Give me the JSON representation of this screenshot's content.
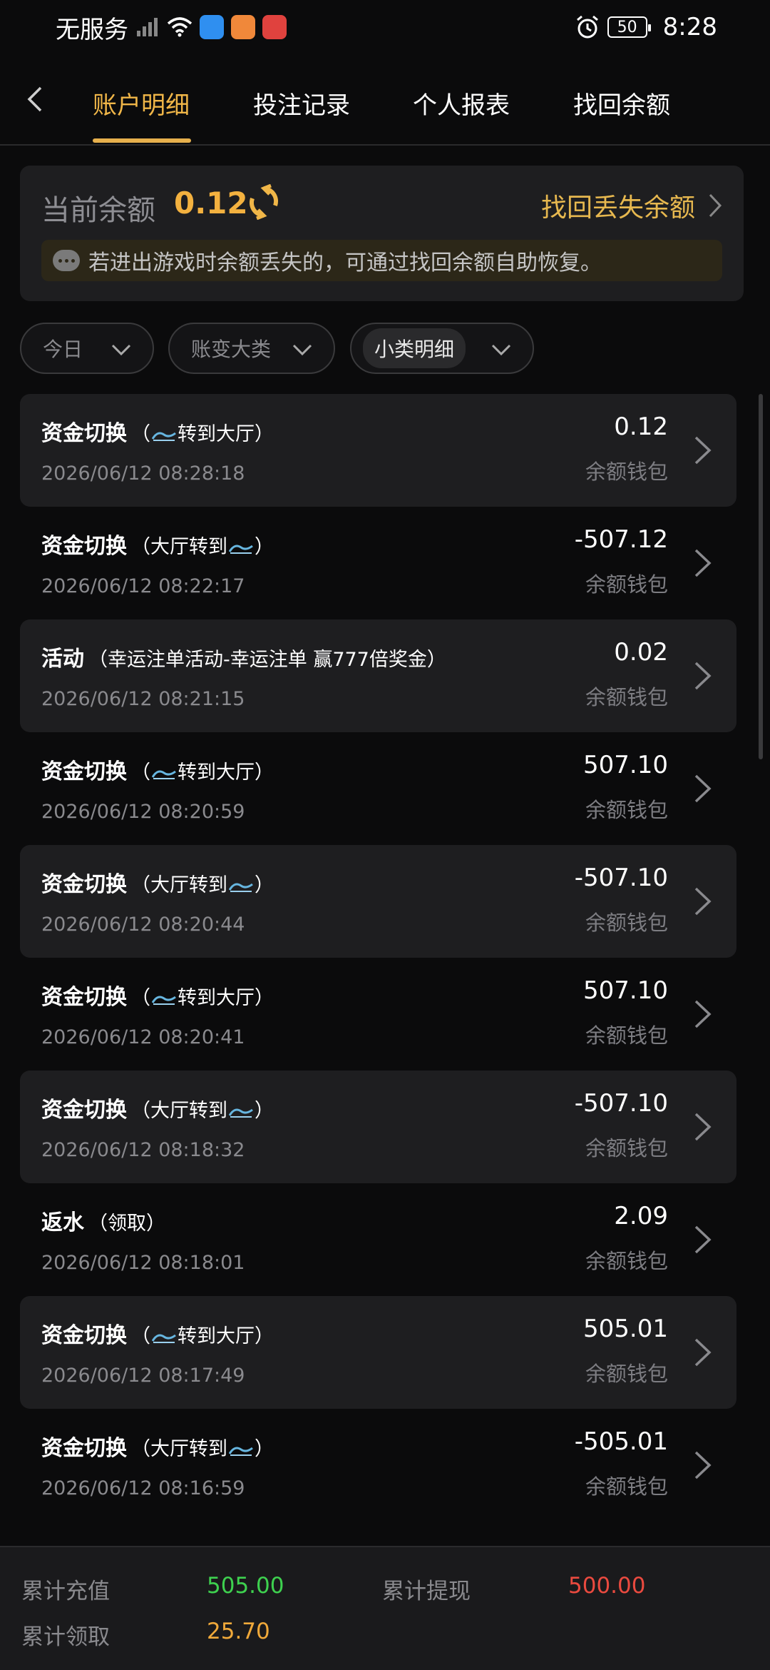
{
  "status_bar": {
    "carrier": "无服务",
    "battery": "50",
    "time": "8:28"
  },
  "header": {
    "tabs": [
      {
        "label": "账户明细",
        "active": true
      },
      {
        "label": "投注记录",
        "active": false
      },
      {
        "label": "个人报表",
        "active": false
      },
      {
        "label": "找回余额",
        "active": false
      }
    ]
  },
  "balance": {
    "label": "当前余额",
    "value": "0.12",
    "recover_label": "找回丢失余额",
    "notice": "若进出游戏时余额丢失的，可通过找回余额自助恢复。"
  },
  "filters": {
    "date": "今日",
    "category": "账变大类",
    "subcategory": "小类明细"
  },
  "transactions": [
    {
      "type": "资金切换",
      "detail_pre": "（",
      "detail_post": "转到大厅）",
      "wave": true,
      "time": "2026/06/12 08:28:18",
      "amount": "0.12",
      "wallet": "余额钱包"
    },
    {
      "type": "资金切换",
      "detail_pre": "（大厅转到",
      "detail_post": "）",
      "wave": true,
      "time": "2026/06/12 08:22:17",
      "amount": "-507.12",
      "wallet": "余额钱包"
    },
    {
      "type": "活动",
      "detail_pre": "（幸运注单活动-幸运注单 赢777倍奖金）",
      "detail_post": "",
      "wave": false,
      "time": "2026/06/12 08:21:15",
      "amount": "0.02",
      "wallet": "余额钱包"
    },
    {
      "type": "资金切换",
      "detail_pre": "（",
      "detail_post": "转到大厅）",
      "wave": true,
      "time": "2026/06/12 08:20:59",
      "amount": "507.10",
      "wallet": "余额钱包"
    },
    {
      "type": "资金切换",
      "detail_pre": "（大厅转到",
      "detail_post": "）",
      "wave": true,
      "time": "2026/06/12 08:20:44",
      "amount": "-507.10",
      "wallet": "余额钱包"
    },
    {
      "type": "资金切换",
      "detail_pre": "（",
      "detail_post": "转到大厅）",
      "wave": true,
      "time": "2026/06/12 08:20:41",
      "amount": "507.10",
      "wallet": "余额钱包"
    },
    {
      "type": "资金切换",
      "detail_pre": "（大厅转到",
      "detail_post": "）",
      "wave": true,
      "time": "2026/06/12 08:18:32",
      "amount": "-507.10",
      "wallet": "余额钱包"
    },
    {
      "type": "返水",
      "detail_pre": "（领取）",
      "detail_post": "",
      "wave": false,
      "time": "2026/06/12 08:18:01",
      "amount": "2.09",
      "wallet": "余额钱包"
    },
    {
      "type": "资金切换",
      "detail_pre": "（",
      "detail_post": "转到大厅）",
      "wave": true,
      "time": "2026/06/12 08:17:49",
      "amount": "505.01",
      "wallet": "余额钱包"
    },
    {
      "type": "资金切换",
      "detail_pre": "（大厅转到",
      "detail_post": "）",
      "wave": true,
      "time": "2026/06/12 08:16:59",
      "amount": "-505.01",
      "wallet": "余额钱包"
    }
  ],
  "summary": {
    "deposit_label": "累计充值",
    "deposit_value": "505.00",
    "withdraw_label": "累计提现",
    "withdraw_value": "500.00",
    "claim_label": "累计领取",
    "claim_value": "25.70"
  },
  "colors": {
    "accent": "#f0b648",
    "deposit": "#3ed14f",
    "withdraw": "#ea4a3f",
    "claim": "#f0a93a"
  }
}
